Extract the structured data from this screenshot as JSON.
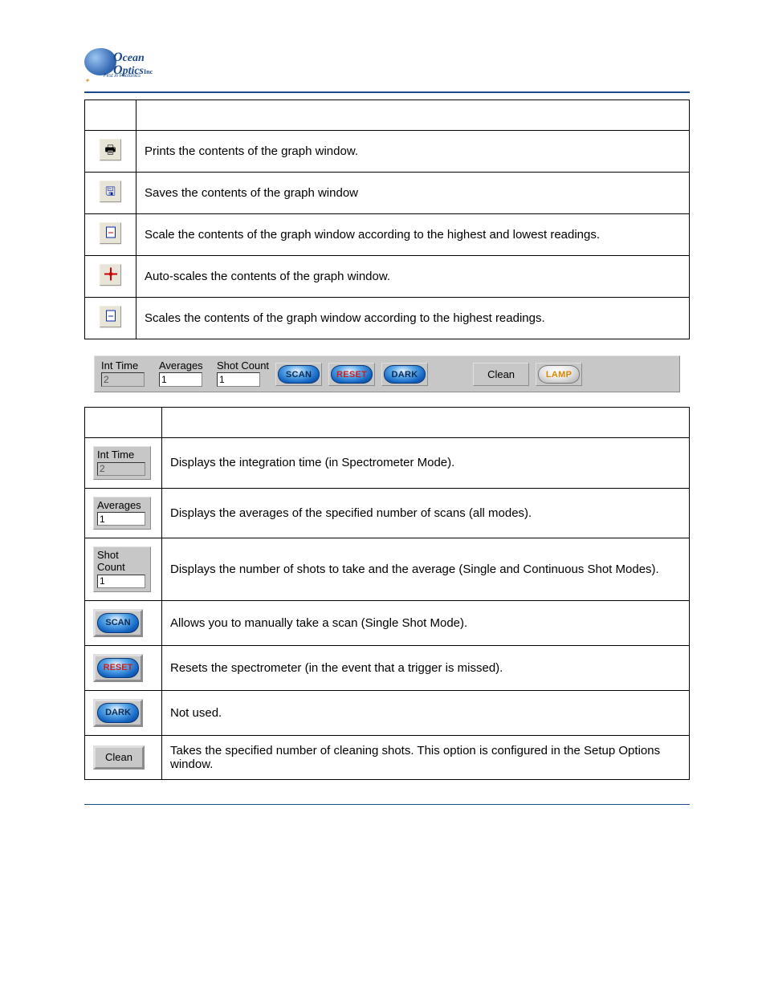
{
  "logo": {
    "line1": "cean",
    "line2": "ptics",
    "suffix": "Inc",
    "slogan": "First in Photonics"
  },
  "table1": {
    "rows": [
      {
        "icon": "print-icon",
        "desc": "Prints the contents of the graph window."
      },
      {
        "icon": "save-icon",
        "desc": "Saves the contents of the graph window"
      },
      {
        "icon": "scale-minmax-icon",
        "desc": "Scale the contents of the graph window according to the highest and lowest readings."
      },
      {
        "icon": "autoscale-icon",
        "desc": "Auto-scales the contents of the graph window."
      },
      {
        "icon": "scale-max-icon",
        "desc": "Scales the contents of the graph window according to the highest readings."
      }
    ]
  },
  "acq_toolbar": {
    "int_time": {
      "label": "Int Time",
      "value": "2",
      "disabled": true
    },
    "averages": {
      "label": "Averages",
      "value": "1"
    },
    "shot_count": {
      "label": "Shot Count",
      "value": "1"
    },
    "scan_label": "SCAN",
    "reset_label": "RESET",
    "dark_label": "DARK",
    "clean_label": "Clean",
    "lamp_label": "LAMP"
  },
  "table2": {
    "rows": [
      {
        "widget": "int-time-field",
        "label": "Int Time",
        "value": "2",
        "disabled": true,
        "desc": "Displays the integration time (in Spectrometer Mode)."
      },
      {
        "widget": "averages-field",
        "label": "Averages",
        "value": "1",
        "desc": "Displays the averages of the specified number of scans (all modes)."
      },
      {
        "widget": "shot-count-field",
        "label": "Shot Count",
        "value": "1",
        "desc": "Displays the number of shots to take and the average (Single and Continuous Shot Modes)."
      },
      {
        "widget": "scan-button",
        "btn": "SCAN",
        "desc": "Allows you to manually take a scan (Single Shot Mode)."
      },
      {
        "widget": "reset-button",
        "btn": "RESET",
        "desc": "Resets the spectrometer (in the event that a trigger is missed)."
      },
      {
        "widget": "dark-button",
        "btn": "DARK",
        "desc": "Not used."
      },
      {
        "widget": "clean-button",
        "btn": "Clean",
        "desc": "Takes the specified number of cleaning shots. This option is configured in the Setup Options window."
      }
    ]
  }
}
